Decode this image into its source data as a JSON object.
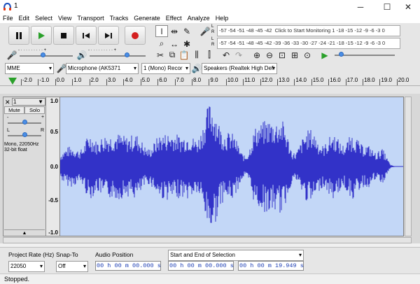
{
  "window": {
    "title": "1"
  },
  "menu": [
    "File",
    "Edit",
    "Select",
    "View",
    "Transport",
    "Tracks",
    "Generate",
    "Effect",
    "Analyze",
    "Help"
  ],
  "record_meter": {
    "l": "L",
    "r": "R",
    "text": "-57 -54 -51 -48 -45 -42",
    "monitor": "Click to Start Monitoring",
    "tail": "1 -18 -15 -12 -9 -6 -3 0"
  },
  "play_meter": {
    "l": "L",
    "r": "R",
    "text": "-57 -54 -51 -48 -45 -42 -39 -36 -33 -30 -27 -24 -21 -18 -15 -12 -9 -6 -3 0"
  },
  "device": {
    "host": "MME",
    "input": "Microphone (AK5371",
    "channels": "1 (Mono) Recor",
    "output": "Speakers (Realtek High Defi"
  },
  "ruler": {
    "ticks": [
      "-2.0",
      "-1.0",
      "0.0",
      "1.0",
      "2.0",
      "3.0",
      "4.0",
      "5.0",
      "6.0",
      "7.0",
      "8.0",
      "9.0",
      "10.0",
      "11.0",
      "12.0",
      "13.0",
      "14.0",
      "15.0",
      "16.0",
      "17.0",
      "18.0",
      "19.0",
      "20.0"
    ]
  },
  "track": {
    "name": "1",
    "mute": "Mute",
    "solo": "Solo",
    "gain_minus": "-",
    "gain_plus": "+",
    "pan_l": "L",
    "pan_r": "R",
    "info1": "Mono, 22050Hz",
    "info2": "32-bit float",
    "collapse": "▲"
  },
  "yaxis": [
    "1.0",
    "0.5",
    "0.0",
    "-0.5",
    "-1.0"
  ],
  "selection_bar": {
    "rate_label": "Project Rate (Hz)",
    "rate_value": "22050",
    "snap_label": "Snap-To",
    "snap_value": "Off",
    "audio_pos_label": "Audio Position",
    "audio_pos_value": "00 h 00 m 00.000 s",
    "sel_label": "Start and End of Selection",
    "sel_start": "00 h 00 m 00.000 s",
    "sel_end": "00 h 00 m 19.949 s"
  },
  "status": "Stopped.",
  "colors": {
    "wave": "#3232c8",
    "wave_bg": "#c3d7f7",
    "play": "#2aa02a",
    "record": "#d42020"
  }
}
